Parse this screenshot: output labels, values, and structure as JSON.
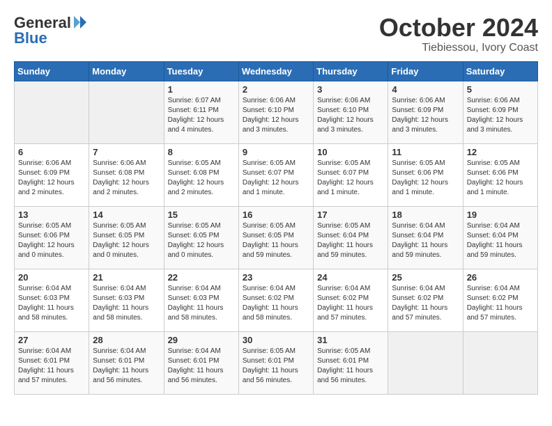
{
  "logo": {
    "general": "General",
    "blue": "Blue"
  },
  "title": "October 2024",
  "location": "Tiebiessou, Ivory Coast",
  "days_header": [
    "Sunday",
    "Monday",
    "Tuesday",
    "Wednesday",
    "Thursday",
    "Friday",
    "Saturday"
  ],
  "weeks": [
    [
      {
        "day": "",
        "empty": true
      },
      {
        "day": "",
        "empty": true
      },
      {
        "day": "1",
        "sunrise": "6:07 AM",
        "sunset": "6:11 PM",
        "daylight": "12 hours and 4 minutes."
      },
      {
        "day": "2",
        "sunrise": "6:06 AM",
        "sunset": "6:10 PM",
        "daylight": "12 hours and 3 minutes."
      },
      {
        "day": "3",
        "sunrise": "6:06 AM",
        "sunset": "6:10 PM",
        "daylight": "12 hours and 3 minutes."
      },
      {
        "day": "4",
        "sunrise": "6:06 AM",
        "sunset": "6:09 PM",
        "daylight": "12 hours and 3 minutes."
      },
      {
        "day": "5",
        "sunrise": "6:06 AM",
        "sunset": "6:09 PM",
        "daylight": "12 hours and 3 minutes."
      }
    ],
    [
      {
        "day": "6",
        "sunrise": "6:06 AM",
        "sunset": "6:09 PM",
        "daylight": "12 hours and 2 minutes."
      },
      {
        "day": "7",
        "sunrise": "6:06 AM",
        "sunset": "6:08 PM",
        "daylight": "12 hours and 2 minutes."
      },
      {
        "day": "8",
        "sunrise": "6:05 AM",
        "sunset": "6:08 PM",
        "daylight": "12 hours and 2 minutes."
      },
      {
        "day": "9",
        "sunrise": "6:05 AM",
        "sunset": "6:07 PM",
        "daylight": "12 hours and 1 minute."
      },
      {
        "day": "10",
        "sunrise": "6:05 AM",
        "sunset": "6:07 PM",
        "daylight": "12 hours and 1 minute."
      },
      {
        "day": "11",
        "sunrise": "6:05 AM",
        "sunset": "6:06 PM",
        "daylight": "12 hours and 1 minute."
      },
      {
        "day": "12",
        "sunrise": "6:05 AM",
        "sunset": "6:06 PM",
        "daylight": "12 hours and 1 minute."
      }
    ],
    [
      {
        "day": "13",
        "sunrise": "6:05 AM",
        "sunset": "6:06 PM",
        "daylight": "12 hours and 0 minutes."
      },
      {
        "day": "14",
        "sunrise": "6:05 AM",
        "sunset": "6:05 PM",
        "daylight": "12 hours and 0 minutes."
      },
      {
        "day": "15",
        "sunrise": "6:05 AM",
        "sunset": "6:05 PM",
        "daylight": "12 hours and 0 minutes."
      },
      {
        "day": "16",
        "sunrise": "6:05 AM",
        "sunset": "6:05 PM",
        "daylight": "11 hours and 59 minutes."
      },
      {
        "day": "17",
        "sunrise": "6:05 AM",
        "sunset": "6:04 PM",
        "daylight": "11 hours and 59 minutes."
      },
      {
        "day": "18",
        "sunrise": "6:04 AM",
        "sunset": "6:04 PM",
        "daylight": "11 hours and 59 minutes."
      },
      {
        "day": "19",
        "sunrise": "6:04 AM",
        "sunset": "6:04 PM",
        "daylight": "11 hours and 59 minutes."
      }
    ],
    [
      {
        "day": "20",
        "sunrise": "6:04 AM",
        "sunset": "6:03 PM",
        "daylight": "11 hours and 58 minutes."
      },
      {
        "day": "21",
        "sunrise": "6:04 AM",
        "sunset": "6:03 PM",
        "daylight": "11 hours and 58 minutes."
      },
      {
        "day": "22",
        "sunrise": "6:04 AM",
        "sunset": "6:03 PM",
        "daylight": "11 hours and 58 minutes."
      },
      {
        "day": "23",
        "sunrise": "6:04 AM",
        "sunset": "6:02 PM",
        "daylight": "11 hours and 58 minutes."
      },
      {
        "day": "24",
        "sunrise": "6:04 AM",
        "sunset": "6:02 PM",
        "daylight": "11 hours and 57 minutes."
      },
      {
        "day": "25",
        "sunrise": "6:04 AM",
        "sunset": "6:02 PM",
        "daylight": "11 hours and 57 minutes."
      },
      {
        "day": "26",
        "sunrise": "6:04 AM",
        "sunset": "6:02 PM",
        "daylight": "11 hours and 57 minutes."
      }
    ],
    [
      {
        "day": "27",
        "sunrise": "6:04 AM",
        "sunset": "6:01 PM",
        "daylight": "11 hours and 57 minutes."
      },
      {
        "day": "28",
        "sunrise": "6:04 AM",
        "sunset": "6:01 PM",
        "daylight": "11 hours and 56 minutes."
      },
      {
        "day": "29",
        "sunrise": "6:04 AM",
        "sunset": "6:01 PM",
        "daylight": "11 hours and 56 minutes."
      },
      {
        "day": "30",
        "sunrise": "6:05 AM",
        "sunset": "6:01 PM",
        "daylight": "11 hours and 56 minutes."
      },
      {
        "day": "31",
        "sunrise": "6:05 AM",
        "sunset": "6:01 PM",
        "daylight": "11 hours and 56 minutes."
      },
      {
        "day": "",
        "empty": true
      },
      {
        "day": "",
        "empty": true
      }
    ]
  ]
}
